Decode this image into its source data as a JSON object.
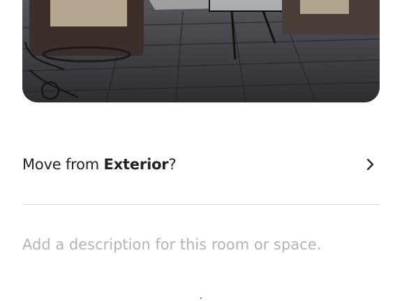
{
  "photo": {
    "alt": "Covered patio with wicker chairs and glass table"
  },
  "move_row": {
    "prefix": "Move from ",
    "room": "Exterior",
    "suffix": "?",
    "icon": "chevron-right-icon"
  },
  "description": {
    "placeholder": "Add a description for this room or space.",
    "value": ""
  },
  "colors": {
    "text": "#222222",
    "placeholder": "#b3b3b3",
    "divider": "#dddddd"
  }
}
